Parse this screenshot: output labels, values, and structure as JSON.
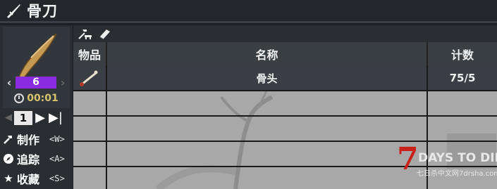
{
  "title": {
    "icon": "knife-icon",
    "text": "骨刀"
  },
  "item_panel": {
    "icon": "bone-knife-item-icon",
    "quality_value": "6",
    "quality_color": "#8a2be2",
    "craft_time": "00:01"
  },
  "quantity": {
    "value": "1",
    "prev_icon": "chevron-left-icon",
    "next_icon": "play-icon",
    "last_icon": "skip-end-icon"
  },
  "actions": [
    {
      "label": "制作",
      "key": "<W>",
      "icon": "hammer-icon"
    },
    {
      "label": "追踪",
      "key": "<A>",
      "icon": "compass-icon"
    },
    {
      "label": "收藏",
      "key": "<S>",
      "icon": "star-icon"
    }
  ],
  "toolbar": {
    "icons": [
      "workbench-icon",
      "recipe-book-icon"
    ]
  },
  "table": {
    "headers": [
      "物品",
      "名称",
      "计数"
    ],
    "rows": [
      {
        "icon": "bone-icon",
        "name": "骨头",
        "count": "75/5"
      }
    ]
  },
  "watermark": {
    "logo_number": "7",
    "logo_text": "DAYS TO DIE",
    "site_text": "七日杀中文网7drsha.com"
  }
}
